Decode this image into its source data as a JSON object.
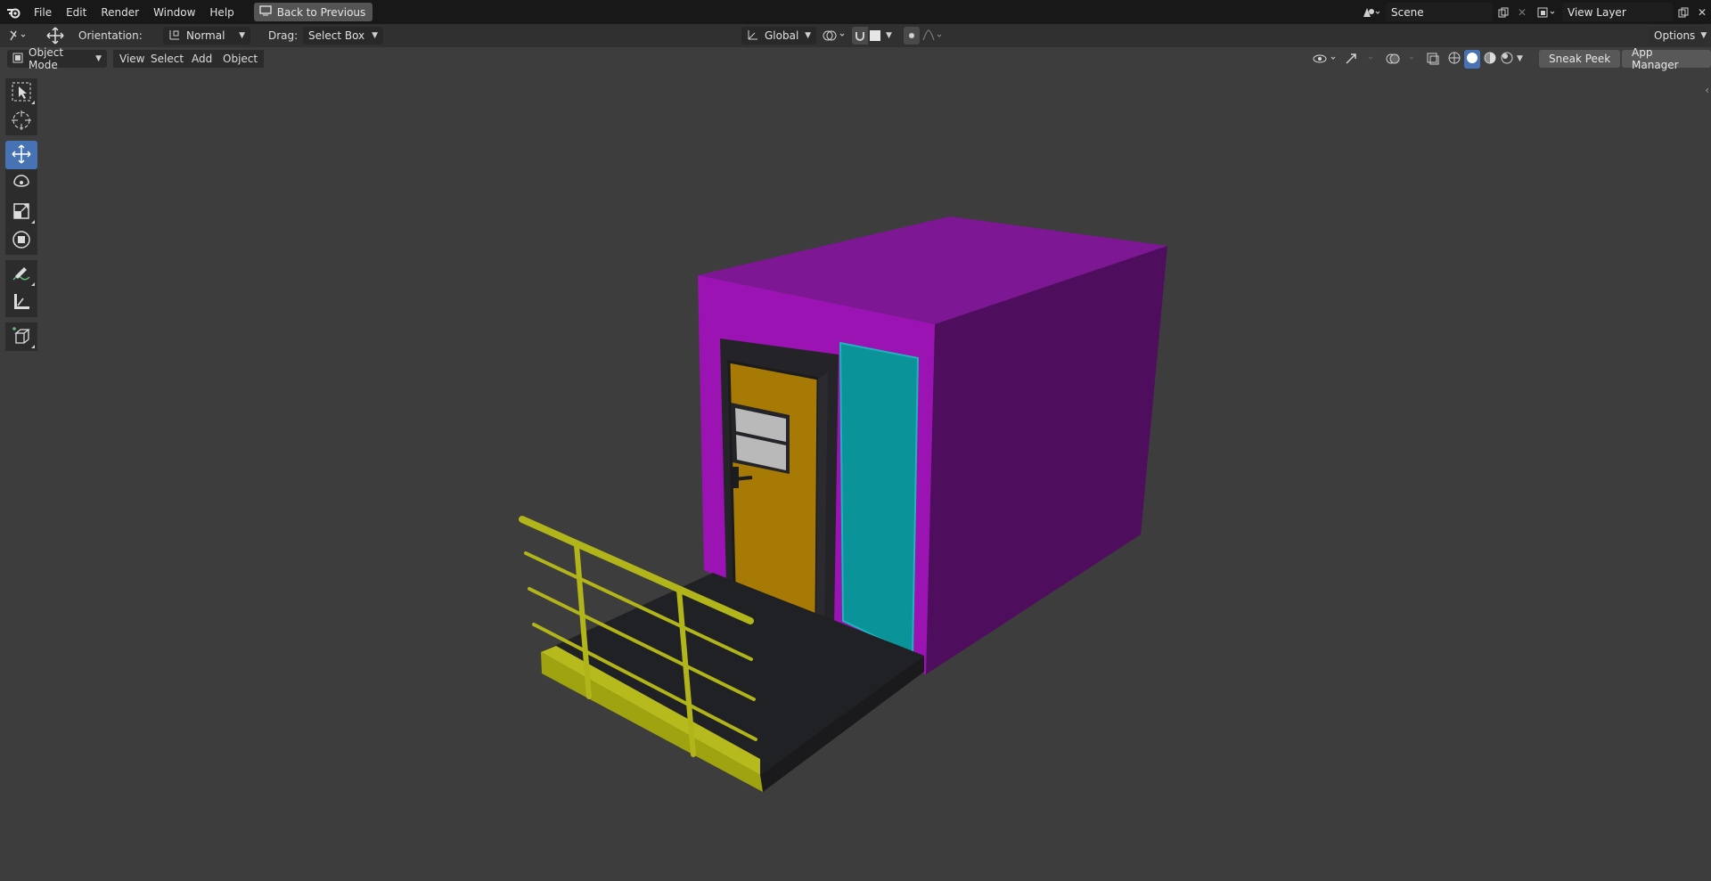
{
  "menu": {
    "file": "File",
    "edit": "Edit",
    "render": "Render",
    "window": "Window",
    "help": "Help",
    "back_to_previous": "Back to Previous"
  },
  "scene": {
    "name": "Scene"
  },
  "view_layer": {
    "name": "View Layer"
  },
  "tool_header": {
    "orientation_label": "Orientation:",
    "orientation_value": "Normal",
    "drag_label": "Drag:",
    "drag_value": "Select Box",
    "transform_orientation": "Global",
    "options": "Options"
  },
  "view_header": {
    "mode": "Object Mode",
    "view": "View",
    "select": "Select",
    "add": "Add",
    "object": "Object",
    "sneak_peek": "Sneak Peek",
    "app_manager": "App Manager"
  },
  "toolbar": {
    "tools": [
      "select-box",
      "cursor",
      "move",
      "rotate",
      "scale",
      "transform",
      "annotate",
      "measure",
      "add-cube"
    ],
    "active_tool": "move"
  },
  "scene_colors": {
    "viewport_bg": "#3d3d3d",
    "box_front": "#9c14b4",
    "box_top": "#7a1592",
    "box_side": "#4e0d5d",
    "door": "#a87b06",
    "panel": "#0a9399",
    "platform": "#202124",
    "railing": "#b4b81a"
  }
}
